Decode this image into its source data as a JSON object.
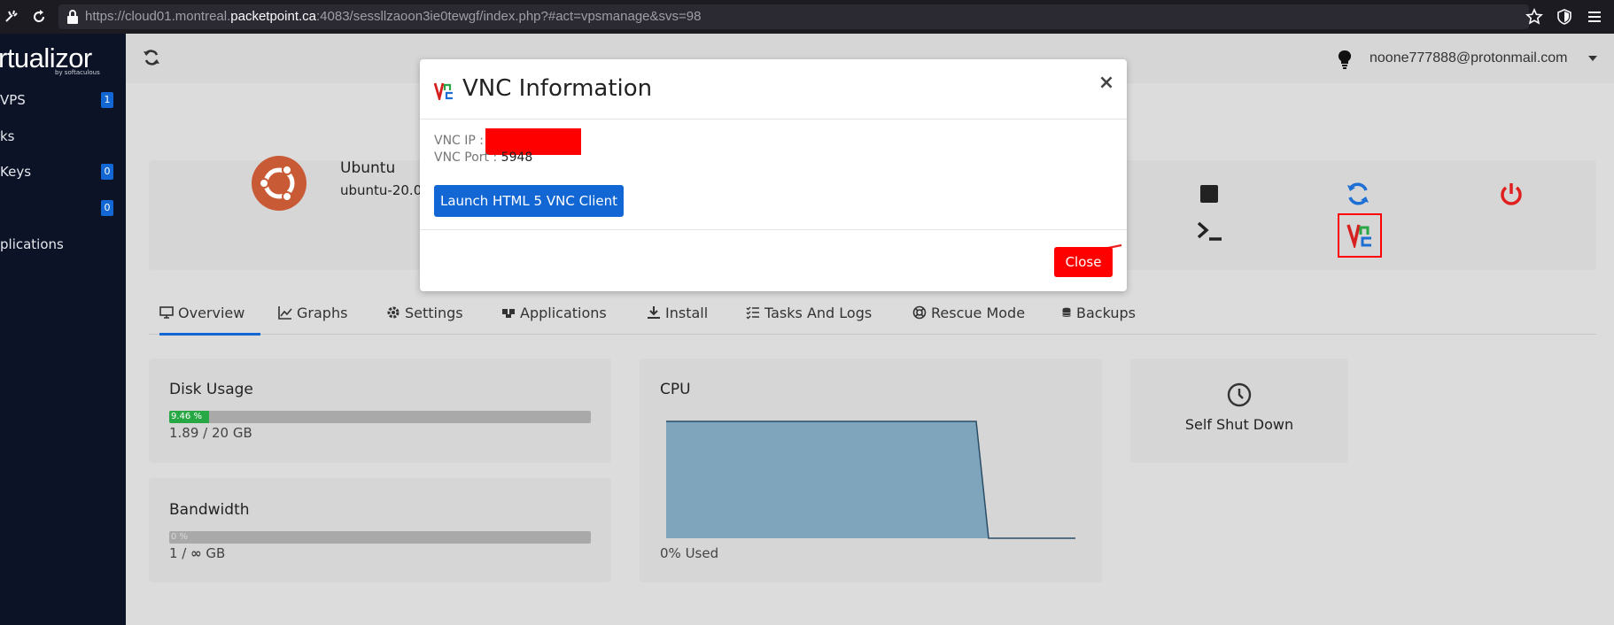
{
  "browser": {
    "url_prefix": "https://cloud01.montreal.",
    "url_host": "packetpoint.ca",
    "url_suffix": ":4083/sessllzaoon3ie0tewgf/index.php?#act=vpsmanage&svs=98"
  },
  "sidebar": {
    "logo": "rtualizor",
    "logo_sub": "by softaculous",
    "items": [
      {
        "label": "VPS",
        "badge": "1"
      },
      {
        "label": "ks",
        "badge": ""
      },
      {
        "label": " Keys",
        "badge": "0"
      },
      {
        "label": "",
        "badge": "0"
      },
      {
        "label": "plications",
        "badge": ""
      }
    ]
  },
  "header": {
    "user_email": "noone777888@protonmail.com"
  },
  "vps": {
    "os_name": "Ubuntu",
    "os_version": "ubuntu-20.0"
  },
  "tabs": [
    {
      "label": "Overview",
      "icon": "monitor-icon"
    },
    {
      "label": "Graphs",
      "icon": "chart-icon"
    },
    {
      "label": "Settings",
      "icon": "gear-icon"
    },
    {
      "label": "Applications",
      "icon": "apps-icon"
    },
    {
      "label": "Install",
      "icon": "download-icon"
    },
    {
      "label": "Tasks And Logs",
      "icon": "tasks-icon"
    },
    {
      "label": "Rescue Mode",
      "icon": "lifebuoy-icon"
    },
    {
      "label": "Backups",
      "icon": "database-icon"
    }
  ],
  "disk": {
    "title": "Disk Usage",
    "percent_label": "9.46 %",
    "percent": 9.46,
    "detail": "1.89 / 20 GB"
  },
  "bandwidth": {
    "title": "Bandwidth",
    "percent_label": "0 %",
    "detail_prefix": "1 / ",
    "detail_infinity": "∞",
    "detail_suffix": " GB"
  },
  "cpu": {
    "title": "CPU",
    "detail": "0% Used",
    "fill_color": "#7fa5bd"
  },
  "self_shutdown": {
    "label": "Self Shut Down"
  },
  "modal": {
    "title": "VNC Information",
    "close_x": "×",
    "vnc_ip_label": "VNC IP : ",
    "vnc_port_label": "VNC Port : ",
    "vnc_port_value": "5948",
    "launch_label": "Launch HTML 5 VNC Client",
    "close_label": "Close"
  },
  "colors": {
    "primary": "#1367d4",
    "danger": "#ff0000",
    "success": "#28a745",
    "sidebar_bg": "#0d1326"
  }
}
